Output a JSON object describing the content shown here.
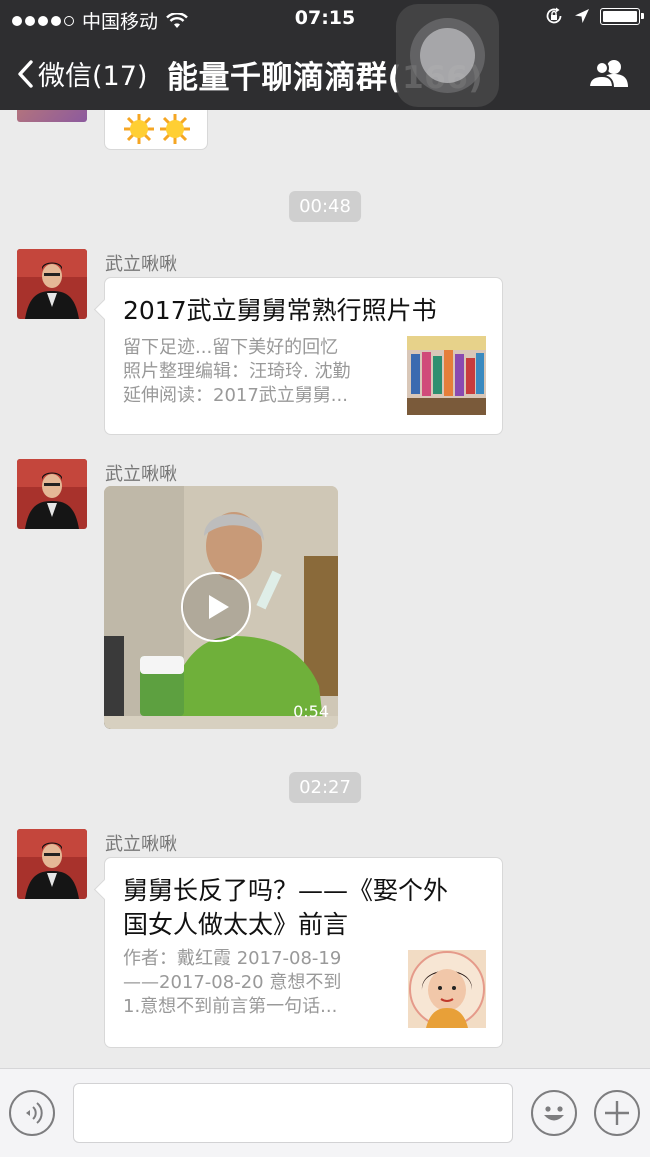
{
  "status_bar": {
    "carrier": "中国移动",
    "time": "07:15",
    "battery_level": 1.0
  },
  "nav": {
    "back_label": "微信(17)",
    "title": "能量千聊滴滴群(166)"
  },
  "chat": {
    "timestamps": [
      "00:48",
      "02:27"
    ],
    "messages": [
      {
        "sender": "武立啾啾",
        "type": "article",
        "title": "2017武立舅舅常熟行照片书",
        "desc_lines": [
          "留下足迹...留下美好的回忆",
          "照片整理编辑：汪琦玲. 沈勤",
          "延伸阅读：2017武立舅舅..."
        ]
      },
      {
        "sender": "武立啾啾",
        "type": "video",
        "duration": "0:54"
      },
      {
        "sender": "武立啾啾",
        "type": "article",
        "title_lines": [
          "舅舅长反了吗？——《娶个外",
          "国女人做太太》前言"
        ],
        "desc_lines": [
          "作者：戴红霞 2017-08-19",
          "——2017-08-20 意想不到",
          "1.意想不到前言第一句话..."
        ]
      }
    ]
  },
  "input_bar": {
    "text_value": ""
  }
}
